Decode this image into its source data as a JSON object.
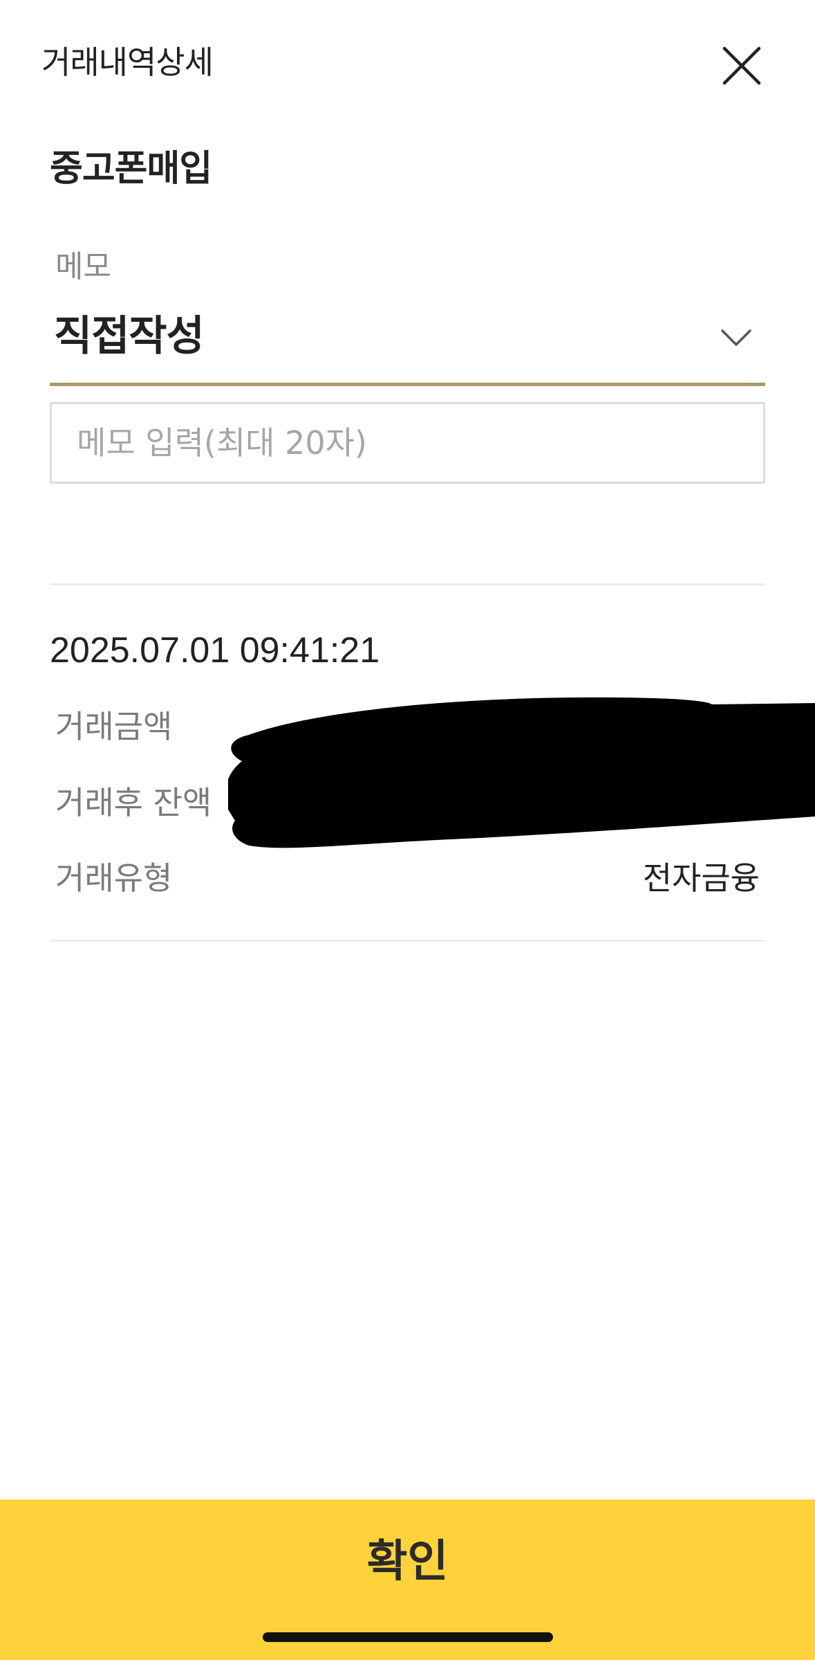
{
  "header": {
    "title": "거래내역상세",
    "close_icon": "close-icon"
  },
  "transaction": {
    "title": "중고폰매입",
    "datetime": "2025.07.01 09:41:21"
  },
  "memo": {
    "label": "메모",
    "selected_option": "직접작성",
    "input_placeholder": "메모 입력(최대 20자)",
    "input_value": ""
  },
  "details": {
    "amount_label": "거래금액",
    "balance_label": "거래후 잔액",
    "type_label": "거래유형",
    "type_value": "전자금융"
  },
  "footer": {
    "confirm_label": "확인"
  },
  "colors": {
    "accent_underline": "#a8996a",
    "confirm_bar": "#fdd23a"
  }
}
